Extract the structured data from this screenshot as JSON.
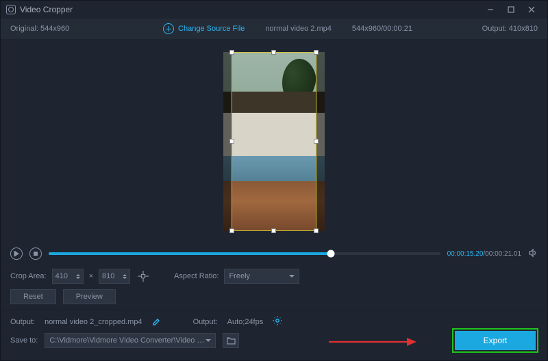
{
  "title": "Video Cropper",
  "window": {
    "minimize": "—",
    "maximize": "□",
    "close": "✕"
  },
  "infobar": {
    "original_label": "Original:",
    "original_dims": "544x960",
    "change_source": "Change Source File",
    "filename": "normal video 2.mp4",
    "source_meta": "544x960/00:00:21",
    "output_label": "Output:",
    "output_dims": "410x810"
  },
  "playback": {
    "current_time": "00:00:15.20",
    "total_time": "00:00:21.01"
  },
  "crop": {
    "area_label": "Crop Area:",
    "width": "410",
    "height": "810",
    "times": "×",
    "aspect_label": "Aspect Ratio:",
    "aspect_value": "Freely",
    "reset": "Reset",
    "preview": "Preview"
  },
  "output": {
    "label": "Output:",
    "filename": "normal video 2_cropped.mp4",
    "format_label": "Output:",
    "format_value": "Auto;24fps"
  },
  "saveto": {
    "label": "Save to:",
    "path": "C:\\Vidmore\\Vidmore Video Converter\\Video Crop"
  },
  "export": {
    "label": "Export"
  }
}
